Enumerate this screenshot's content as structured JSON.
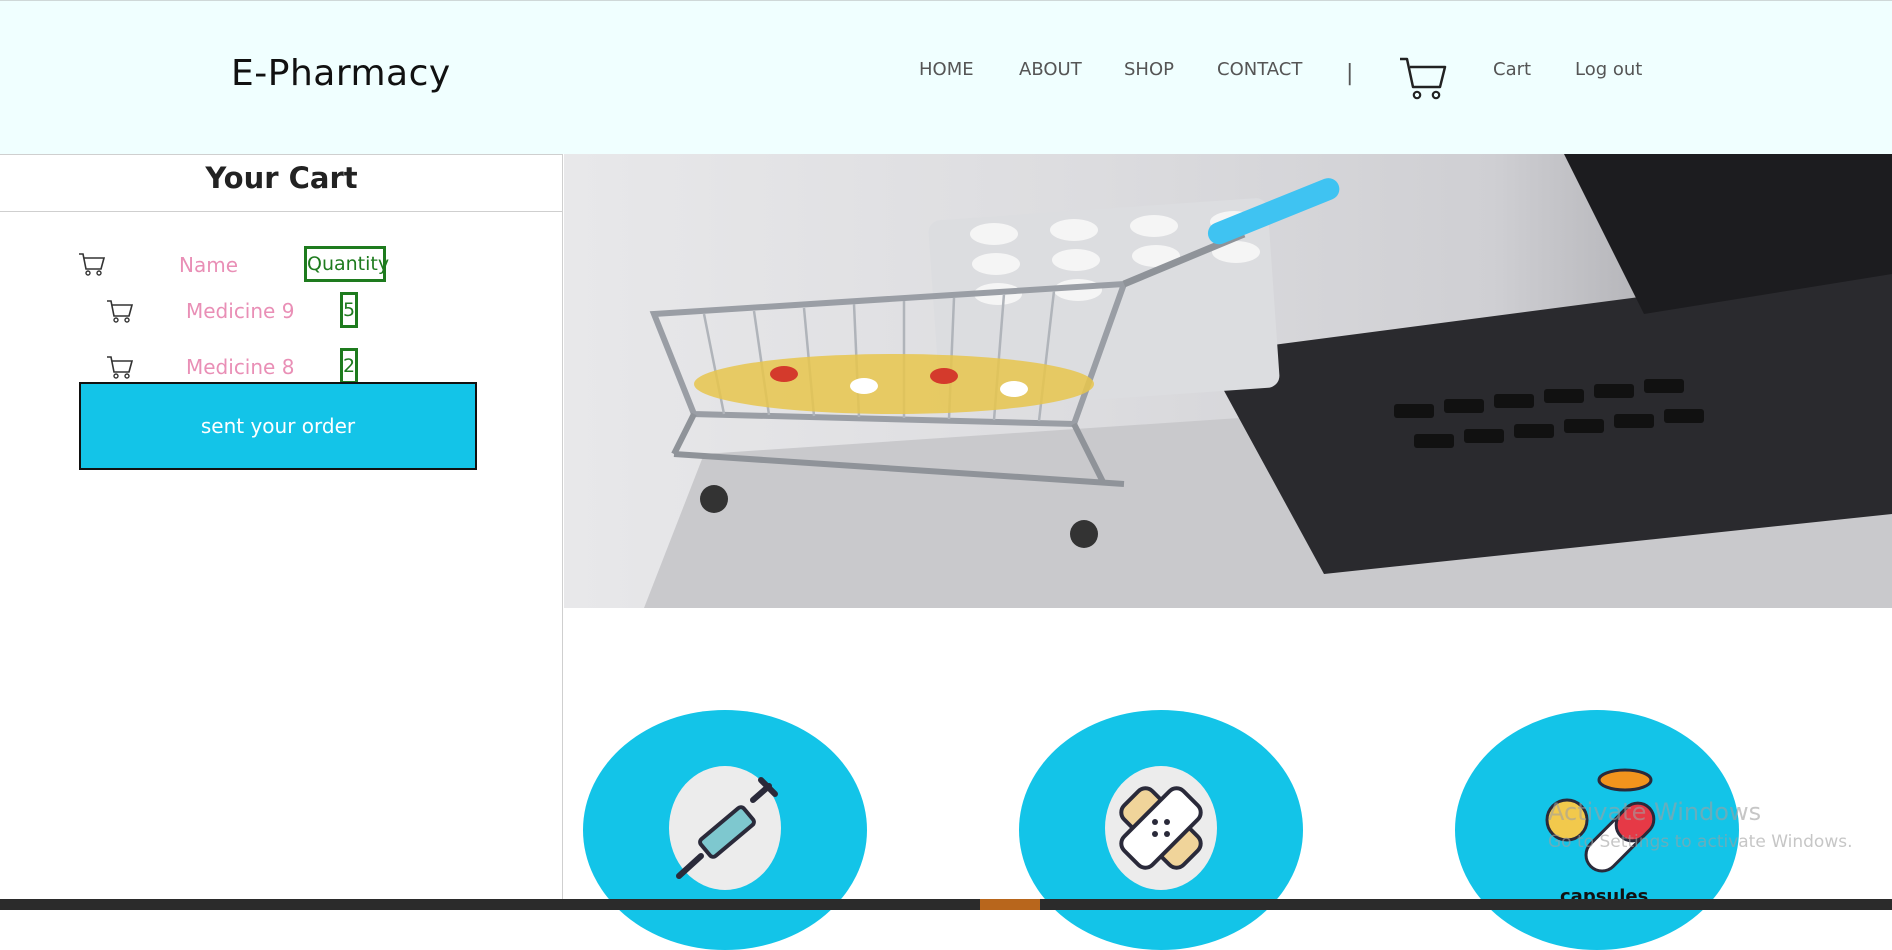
{
  "header": {
    "brand": "E-Pharmacy",
    "nav": [
      "HOME",
      "ABOUT",
      "SHOP",
      "CONTACT"
    ],
    "separator": "|",
    "cart_label": "Cart",
    "logout_label": "Log out"
  },
  "cart": {
    "title": "Your Cart",
    "columns": {
      "name": "Name",
      "quantity": "Quantity"
    },
    "items": [
      {
        "name": "Medicine 9",
        "quantity": "5"
      },
      {
        "name": "Medicine 8",
        "quantity": "2"
      }
    ],
    "order_button": "sent your order"
  },
  "categories": [
    {
      "icon": "syringe-icon",
      "label": ""
    },
    {
      "icon": "bandage-icon",
      "label": ""
    },
    {
      "icon": "capsule-icon",
      "label": "capsules"
    }
  ],
  "watermark": {
    "line1": "Activate Windows",
    "line2": "Go to Settings to activate Windows."
  },
  "colors": {
    "header_bg": "#f0ffff",
    "accent": "#13c4e8",
    "item_text": "#e98fb6",
    "quantity_border": "#1e7b1e"
  }
}
